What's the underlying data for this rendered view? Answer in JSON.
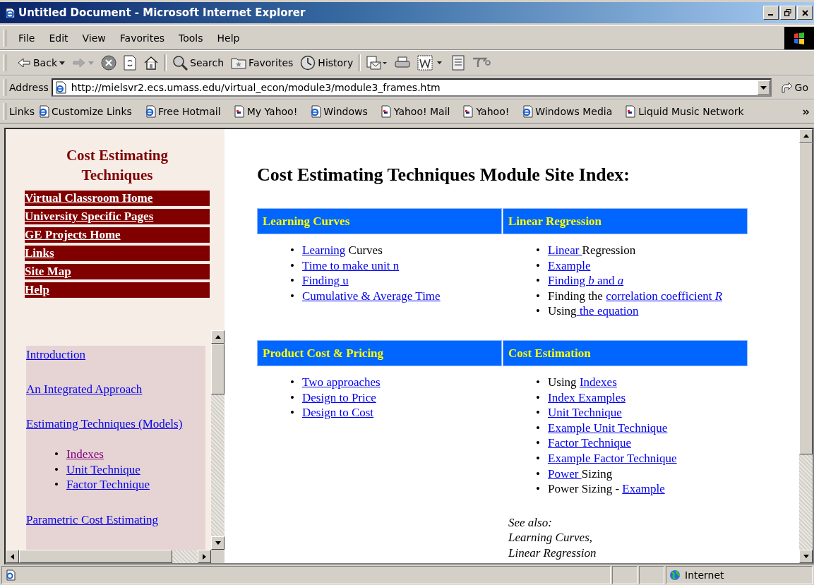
{
  "window": {
    "title": "Untitled Document - Microsoft Internet Explorer"
  },
  "menu": [
    "File",
    "Edit",
    "View",
    "Favorites",
    "Tools",
    "Help"
  ],
  "toolbar": [
    {
      "kind": "back",
      "label": "Back"
    },
    {
      "kind": "forward"
    },
    {
      "kind": "stop"
    },
    {
      "kind": "refresh"
    },
    {
      "kind": "home"
    },
    {
      "kind": "search",
      "label": "Search"
    },
    {
      "kind": "favorites",
      "label": "Favorites"
    },
    {
      "kind": "history",
      "label": "History"
    },
    {
      "kind": "mail"
    },
    {
      "kind": "print"
    },
    {
      "kind": "edit"
    },
    {
      "kind": "discuss"
    },
    {
      "kind": "messenger"
    }
  ],
  "address": {
    "label": "Address",
    "value": "http://mielsvr2.ecs.umass.edu/virtual_econ/module3/module3_frames.htm",
    "go": "Go"
  },
  "links": {
    "label": "Links",
    "items": [
      {
        "label": "Customize Links",
        "kind": "ie"
      },
      {
        "label": "Free Hotmail",
        "kind": "ie"
      },
      {
        "label": "My Yahoo!",
        "kind": "page"
      },
      {
        "label": "Windows",
        "kind": "ie"
      },
      {
        "label": "Yahoo! Mail",
        "kind": "page"
      },
      {
        "label": "Yahoo!",
        "kind": "page"
      },
      {
        "label": "Windows Media",
        "kind": "ie"
      },
      {
        "label": "Liquid Music Network",
        "kind": "page"
      }
    ]
  },
  "sidebar": {
    "title": "Cost Estimating Techniques",
    "nav": [
      "Virtual Classroom Home",
      "University Specific Pages",
      "GE Projects Home",
      "Links",
      "Site Map",
      "Help"
    ],
    "toc": [
      {
        "label": "Introduction",
        "visited": false
      },
      {
        "label": "An Integrated Approach",
        "visited": false
      },
      {
        "label": "Estimating Techniques (Models)",
        "visited": false,
        "children": [
          {
            "marker": "•",
            "label": "Indexes",
            "visited": true
          },
          {
            "marker": "•",
            "label": "Unit Technique",
            "visited": false
          },
          {
            "marker": "•",
            "label": "Factor Technique",
            "visited": false
          }
        ]
      },
      {
        "label": "Parametric Cost Estimating",
        "visited": false
      }
    ]
  },
  "main": {
    "heading": "Cost Estimating Techniques Module Site Index:",
    "sections": [
      {
        "title": "Learning Curves",
        "items": [
          {
            "marker": "•",
            "parts": [
              {
                "text": "Learning",
                "link": true
              },
              {
                "text": " Curves",
                "link": false
              }
            ]
          },
          {
            "marker": "•",
            "parts": [
              {
                "text": "Time to make unit n",
                "link": true
              }
            ]
          },
          {
            "marker": "•",
            "parts": [
              {
                "text": "Finding u",
                "link": true
              }
            ]
          },
          {
            "marker": "•",
            "parts": [
              {
                "text": "Cumulative & Average Time",
                "link": true
              }
            ]
          }
        ]
      },
      {
        "title": "Linear Regression",
        "items": [
          {
            "marker": "•",
            "parts": [
              {
                "text": "Linear ",
                "link": true
              },
              {
                "text": "Regression",
                "link": false
              }
            ]
          },
          {
            "marker": "•",
            "parts": [
              {
                "text": "Example",
                "link": true
              }
            ]
          },
          {
            "marker": "•",
            "parts": [
              {
                "text": "Finding *b* and *a*",
                "link": true
              }
            ]
          },
          {
            "marker": "•",
            "parts": [
              {
                "text": "Finding the ",
                "link": false
              },
              {
                "text": "correlation coefficient *R*",
                "link": true
              }
            ]
          },
          {
            "marker": "•",
            "parts": [
              {
                "text": "Using",
                "link": false
              },
              {
                "text": " the equation",
                "link": true
              }
            ]
          }
        ]
      },
      {
        "title": "Product Cost & Pricing",
        "items": [
          {
            "marker": "•",
            "parts": [
              {
                "text": "Two approaches",
                "link": true
              }
            ]
          },
          {
            "marker": "•",
            "parts": [
              {
                "text": "Design to Price",
                "link": true
              }
            ]
          },
          {
            "marker": "•",
            "parts": [
              {
                "text": "Design to Cost",
                "link": true
              }
            ]
          }
        ]
      },
      {
        "title": "Cost Estimation",
        "items": [
          {
            "marker": "•",
            "parts": [
              {
                "text": "Using ",
                "link": false
              },
              {
                "text": "Indexes",
                "link": true
              }
            ]
          },
          {
            "marker": "•",
            "parts": [
              {
                "text": "Index Examples",
                "link": true
              }
            ]
          },
          {
            "marker": "•",
            "parts": [
              {
                "text": "Unit Technique",
                "link": true
              }
            ]
          },
          {
            "marker": "•",
            "parts": [
              {
                "text": "Example Unit Technique",
                "link": true
              }
            ]
          },
          {
            "marker": "•",
            "parts": [
              {
                "text": "Factor Technique",
                "link": true
              }
            ]
          },
          {
            "marker": "•",
            "parts": [
              {
                "text": "Example Factor Technique",
                "link": true
              }
            ]
          },
          {
            "marker": "•",
            "parts": [
              {
                "text": "Power ",
                "link": true
              },
              {
                "text": "Sizing",
                "link": false
              }
            ]
          },
          {
            "marker": "•",
            "parts": [
              {
                "text": "Power Sizing - ",
                "link": false
              },
              {
                "text": "Example",
                "link": true
              }
            ]
          }
        ],
        "note": [
          "See also:",
          "Learning Curves,",
          "Linear Regression"
        ]
      }
    ]
  },
  "status": {
    "zone": "Internet"
  }
}
